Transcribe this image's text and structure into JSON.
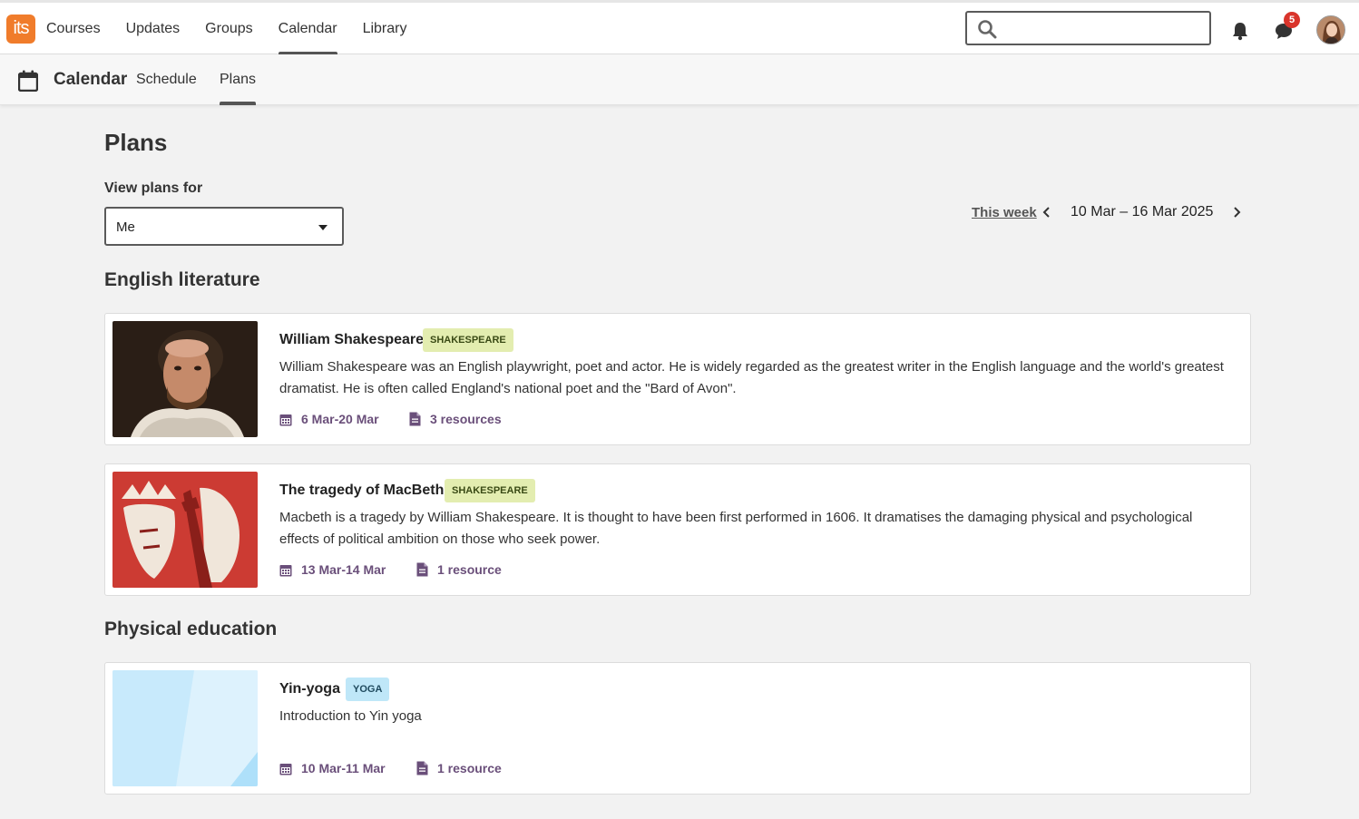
{
  "app": {
    "logo_text": "its"
  },
  "topnav": {
    "items": [
      {
        "label": "Courses",
        "active": false
      },
      {
        "label": "Updates",
        "active": false
      },
      {
        "label": "Groups",
        "active": false
      },
      {
        "label": "Calendar",
        "active": true
      },
      {
        "label": "Library",
        "active": false
      }
    ],
    "search": {
      "value": "",
      "placeholder": ""
    },
    "notifications_icon": "bell-icon",
    "messages_icon": "chat-icon",
    "messages_badge": "5"
  },
  "subnav": {
    "icon": "calendar-icon",
    "title": "Calendar",
    "tabs": [
      {
        "label": "Schedule",
        "active": false
      },
      {
        "label": "Plans",
        "active": true
      }
    ]
  },
  "page": {
    "title": "Plans",
    "view_for_label": "View plans for",
    "view_for_value": "Me",
    "this_week_label": "This week",
    "date_range": "10 Mar – 16 Mar 2025"
  },
  "sections": [
    {
      "title": "English literature",
      "plans": [
        {
          "title": "William Shakespeare",
          "tag": "SHAKESPEARE",
          "description": "William Shakespeare was an English playwright, poet and actor. He is widely regarded as the greatest writer in the English language and the world's greatest dramatist. He is often called England's national poet and the \"Bard of Avon\".",
          "dates": "6 Mar-20 Mar",
          "resources": "3 resources"
        },
        {
          "title": "The tragedy of MacBeth",
          "tag": "SHAKESPEARE",
          "description": "Macbeth is a tragedy by William Shakespeare. It is thought to have been first performed in 1606. It dramatises the damaging physical and psychological effects of political ambition on those who seek power.",
          "dates": "13 Mar-14 Mar",
          "resources": "1 resource"
        }
      ]
    },
    {
      "title": "Physical education",
      "plans": [
        {
          "title": "Yin-yoga",
          "tag": "YOGA",
          "description": "Introduction to Yin yoga",
          "dates": "10 Mar-11 Mar",
          "resources": "1 resource"
        }
      ]
    }
  ],
  "colors": {
    "logo": "#f07c2b",
    "badge": "#d9342b",
    "meta_text": "#6a4f7a",
    "tag_shakespeare": "#e3edb0",
    "tag_yoga": "#bfe7f8"
  }
}
